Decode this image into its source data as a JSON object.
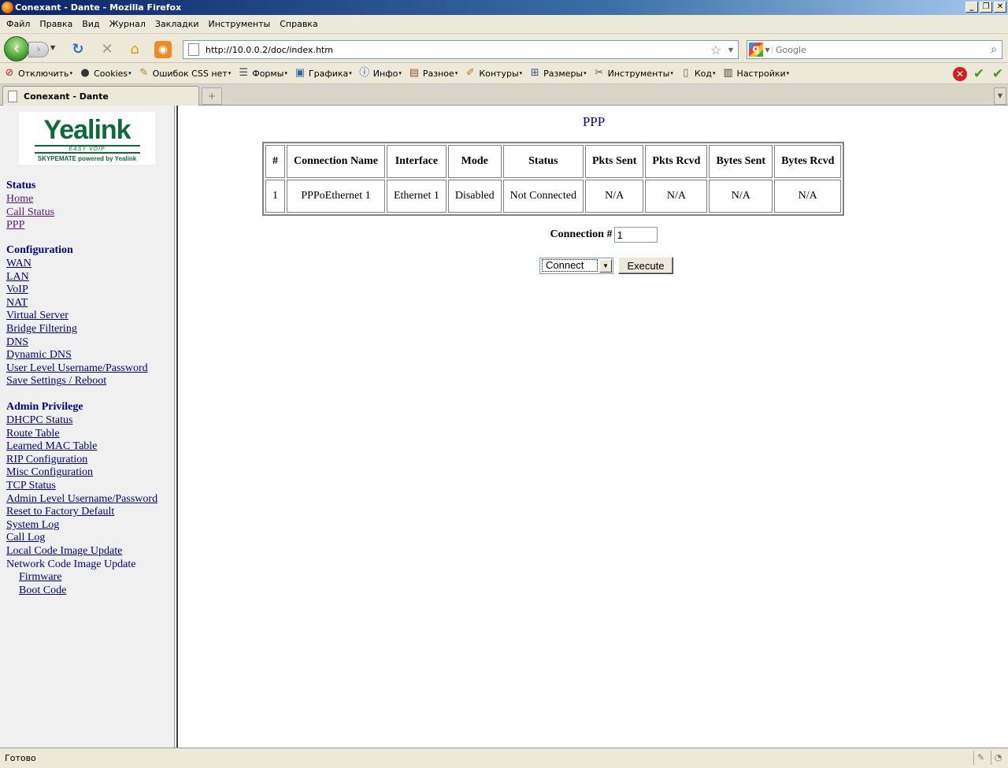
{
  "window": {
    "title": "Conexant - Dante - Mozilla Firefox"
  },
  "menubar": {
    "items": [
      "Файл",
      "Правка",
      "Вид",
      "Журнал",
      "Закладки",
      "Инструменты",
      "Справка"
    ]
  },
  "navbar": {
    "url": "http://10.0.0.2/doc/index.htm",
    "search_placeholder": "Google"
  },
  "devbar": {
    "items": [
      {
        "label": "Отключить",
        "icon": "disable-icon"
      },
      {
        "label": "Cookies",
        "icon": "cookie-icon"
      },
      {
        "label": "Ошибок CSS нет",
        "icon": "css-icon"
      },
      {
        "label": "Формы",
        "icon": "forms-icon"
      },
      {
        "label": "Графика",
        "icon": "images-icon"
      },
      {
        "label": "Инфо",
        "icon": "info-icon"
      },
      {
        "label": "Разное",
        "icon": "misc-icon"
      },
      {
        "label": "Контуры",
        "icon": "outline-icon"
      },
      {
        "label": "Размеры",
        "icon": "resize-icon"
      },
      {
        "label": "Инструменты",
        "icon": "tools-icon"
      },
      {
        "label": "Код",
        "icon": "source-icon"
      },
      {
        "label": "Настройки",
        "icon": "options-icon"
      }
    ]
  },
  "tabs": {
    "active_label": "Conexant - Dante"
  },
  "sidebar": {
    "logo": {
      "wordmark": "Yealink",
      "tagline": "EASY VOIP",
      "subline": "SKYPEMATE powered by Yealink"
    },
    "sections": [
      {
        "heading": "Status",
        "links": [
          {
            "label": "Home",
            "visited": true
          },
          {
            "label": "Call Status",
            "visited": true
          },
          {
            "label": "PPP",
            "visited": true
          }
        ]
      },
      {
        "heading": "Configuration",
        "links": [
          {
            "label": "WAN"
          },
          {
            "label": "LAN"
          },
          {
            "label": "VoIP"
          },
          {
            "label": "NAT"
          },
          {
            "label": "Virtual Server"
          },
          {
            "label": "Bridge Filtering"
          },
          {
            "label": "DNS"
          },
          {
            "label": "Dynamic DNS"
          },
          {
            "label": "User Level Username/Password"
          },
          {
            "label": "Save Settings / Reboot"
          }
        ]
      },
      {
        "heading": "Admin Privilege",
        "links": [
          {
            "label": "DHCPC Status"
          },
          {
            "label": "Route Table"
          },
          {
            "label": "Learned MAC Table"
          },
          {
            "label": "RIP Configuration"
          },
          {
            "label": "Misc Configuration"
          },
          {
            "label": "TCP Status"
          },
          {
            "label": "Admin Level Username/Password"
          },
          {
            "label": "Reset to Factory Default"
          },
          {
            "label": "System Log"
          },
          {
            "label": "Call Log"
          },
          {
            "label": "Local Code Image Update"
          },
          {
            "label": "Network Code Image Update",
            "plain": true
          },
          {
            "label": "Firmware",
            "sub": true
          },
          {
            "label": "Boot Code",
            "sub": true
          }
        ]
      }
    ]
  },
  "main": {
    "title": "PPP",
    "table": {
      "headers": [
        "#",
        "Connection Name",
        "Interface",
        "Mode",
        "Status",
        "Pkts Sent",
        "Pkts Rcvd",
        "Bytes Sent",
        "Bytes Rcvd"
      ],
      "rows": [
        [
          "1",
          "PPPoEthernet 1",
          "Ethernet 1",
          "Disabled",
          "Not Connected",
          "N/A",
          "N/A",
          "N/A",
          "N/A"
        ]
      ]
    },
    "connection_label": "Connection #",
    "connection_value": "1",
    "action_selected": "Connect",
    "execute_label": "Execute"
  },
  "statusbar": {
    "text": "Готово"
  }
}
